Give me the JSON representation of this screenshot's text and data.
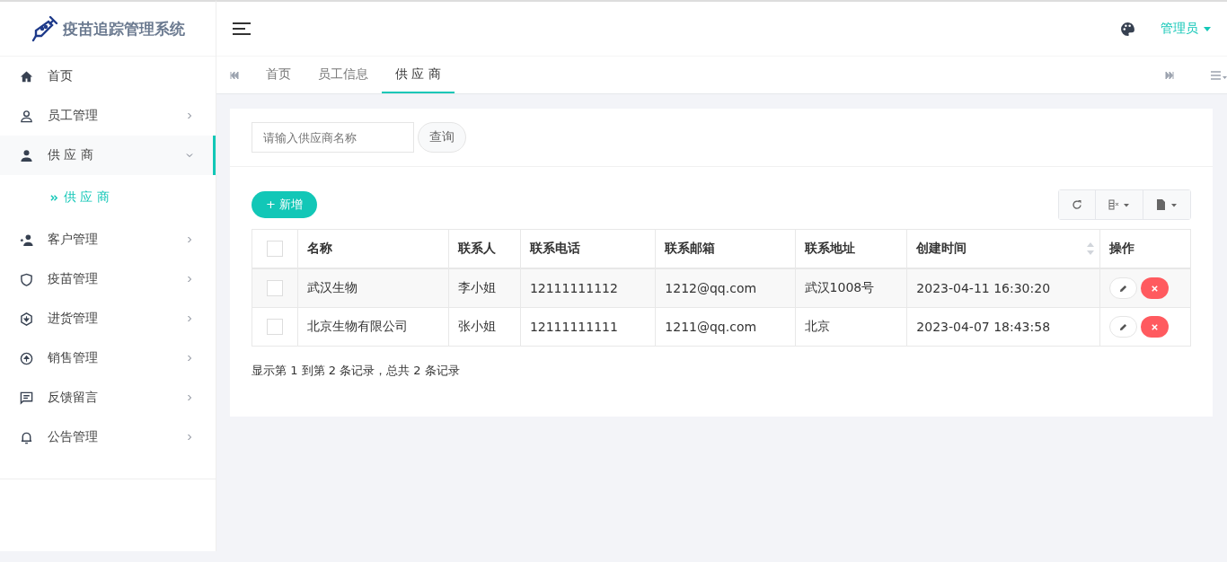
{
  "brand": {
    "title": "疫苗追踪管理系统"
  },
  "sidebar": {
    "items": [
      {
        "label": "首页",
        "selected": false
      },
      {
        "label": "员工管理",
        "expanded": false,
        "selected": false
      },
      {
        "label": "供 应 商",
        "expanded": true,
        "selected": true,
        "children": [
          {
            "label": "供 应 商",
            "selected": true
          }
        ]
      },
      {
        "label": "客户管理",
        "expanded": false,
        "selected": false
      },
      {
        "label": "疫苗管理",
        "expanded": false,
        "selected": false
      },
      {
        "label": "进货管理",
        "expanded": false,
        "selected": false
      },
      {
        "label": "销售管理",
        "expanded": false,
        "selected": false
      },
      {
        "label": "反馈留言",
        "expanded": false,
        "selected": false
      },
      {
        "label": "公告管理",
        "expanded": false,
        "selected": false
      }
    ]
  },
  "header": {
    "user": "管理员"
  },
  "tabs": [
    {
      "label": "首页",
      "selected": false
    },
    {
      "label": "员工信息",
      "selected": false
    },
    {
      "label": "供 应 商",
      "selected": true
    }
  ],
  "search": {
    "placeholder": "请输入供应商名称",
    "button": "查询"
  },
  "add_button": "+ 新增",
  "table": {
    "select_all_checked": false,
    "columns": [
      {
        "label": "名称"
      },
      {
        "label": "联系人"
      },
      {
        "label": "联系电话"
      },
      {
        "label": "联系邮箱"
      },
      {
        "label": "联系地址"
      },
      {
        "label": "创建时间",
        "sortable": true
      },
      {
        "label": "操作"
      }
    ],
    "rows": [
      {
        "checked": false,
        "cells": [
          "武汉生物",
          "李小姐",
          "12111111112",
          "1212@qq.com",
          "武汉1008号",
          "2023-04-11 16:30:20"
        ]
      },
      {
        "checked": false,
        "cells": [
          "北京生物有限公司",
          "张小姐",
          "12111111111",
          "1211@qq.com",
          "北京",
          "2023-04-07 18:43:58"
        ]
      }
    ]
  },
  "pagination_info": "显示第 1 到第 2 条记录，总共 2 条记录"
}
